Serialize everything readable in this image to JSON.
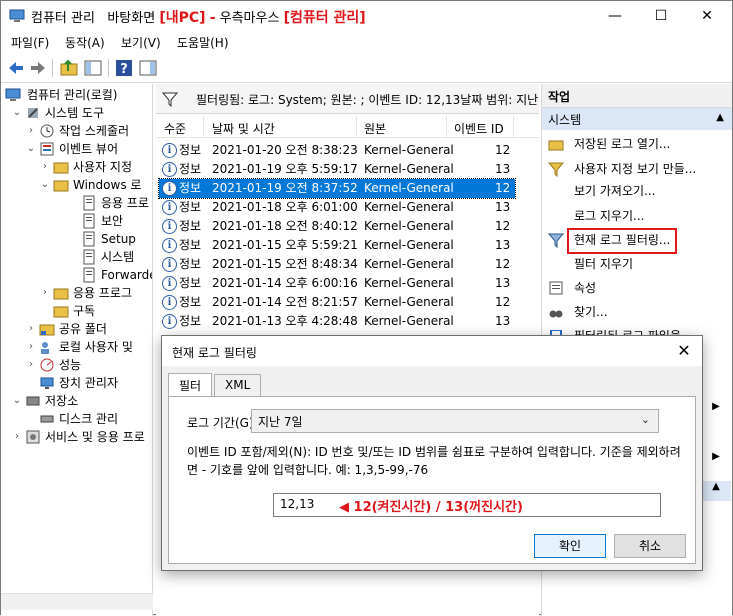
{
  "titlebar": {
    "app_title": "컴퓨터 관리",
    "desktop_label": "바탕화면",
    "tag_pc": "[내PC]",
    "dash": "-",
    "right_click": "우측마우스",
    "tag_cm": "[컴퓨터 관리]",
    "min_glyph": "—",
    "max_glyph": "☐",
    "close_glyph": "✕"
  },
  "menu": [
    "파일(F)",
    "동작(A)",
    "보기(V)",
    "도움말(H)"
  ],
  "tree": {
    "root": "컴퓨터 관리(로컬)",
    "items": [
      {
        "label": "시스템 도구",
        "level": 1
      },
      {
        "label": "작업 스케줄러",
        "level": 2
      },
      {
        "label": "이벤트 뷰어",
        "level": 2
      },
      {
        "label": "사용자 지정",
        "level": 3
      },
      {
        "label": "Windows 로",
        "level": 3
      },
      {
        "label": "응용 프로",
        "level": 4
      },
      {
        "label": "보안",
        "level": 4
      },
      {
        "label": "Setup",
        "level": 4
      },
      {
        "label": "시스템",
        "level": 4
      },
      {
        "label": "Forwarde",
        "level": 4
      },
      {
        "label": "응용 프로그",
        "level": 3
      },
      {
        "label": "구독",
        "level": 3
      },
      {
        "label": "공유 폴더",
        "level": 2
      },
      {
        "label": "로컬 사용자 및",
        "level": 2
      },
      {
        "label": "성능",
        "level": 2
      },
      {
        "label": "장치 관리자",
        "level": 2
      },
      {
        "label": "저장소",
        "level": 1
      },
      {
        "label": "디스크 관리",
        "level": 2
      },
      {
        "label": "서비스 및 응용 프로",
        "level": 1
      }
    ]
  },
  "filterbar": {
    "text": "필터링됨: 로그: System; 원본: ; 이벤트 ID: 12,13날짜 범위: 지난"
  },
  "grid": {
    "columns": [
      "수준",
      "날짜 및 시간",
      "원본",
      "이벤트 ID"
    ],
    "rows": [
      {
        "level": "정보",
        "datetime": "2021-01-20 오전 8:38:23",
        "source": "Kernel-General",
        "id": "12"
      },
      {
        "level": "정보",
        "datetime": "2021-01-19 오후 5:59:17",
        "source": "Kernel-General",
        "id": "13"
      },
      {
        "level": "정보",
        "datetime": "2021-01-19 오전 8:37:52",
        "source": "Kernel-General",
        "id": "12"
      },
      {
        "level": "정보",
        "datetime": "2021-01-18 오후 6:01:00",
        "source": "Kernel-General",
        "id": "13"
      },
      {
        "level": "정보",
        "datetime": "2021-01-18 오전 8:40:12",
        "source": "Kernel-General",
        "id": "12"
      },
      {
        "level": "정보",
        "datetime": "2021-01-15 오후 5:59:21",
        "source": "Kernel-General",
        "id": "13"
      },
      {
        "level": "정보",
        "datetime": "2021-01-15 오전 8:48:34",
        "source": "Kernel-General",
        "id": "12"
      },
      {
        "level": "정보",
        "datetime": "2021-01-14 오후 6:00:16",
        "source": "Kernel-General",
        "id": "13"
      },
      {
        "level": "정보",
        "datetime": "2021-01-14 오전 8:21:57",
        "source": "Kernel-General",
        "id": "12"
      },
      {
        "level": "정보",
        "datetime": "2021-01-13 오후 4:28:48",
        "source": "Kernel-General",
        "id": "13"
      }
    ],
    "selected_index": 2
  },
  "actions": {
    "header": "작업",
    "section": "시스템",
    "items": [
      "저장된 로그 열기...",
      "사용자 지정 보기 만들...",
      "보기 가져오기...",
      "로그 지우기...",
      "현재 로그 필터링...",
      "필터 지우기",
      "속성",
      "찾기...",
      "필터링된 로그 파일을..."
    ]
  },
  "dialog": {
    "title": "현재 로그 필터링",
    "close_glyph": "✕",
    "tabs": [
      "필터",
      "XML"
    ],
    "period_label": "로그 기간(G):",
    "period_value": "지난 7일",
    "desc": "이벤트 ID 포함/제외(N): ID 번호 및/또는 ID 범위를 쉼표로 구분하여 입력합니다. 기준을 제외하려면 - 기호를 앞에 입력합니다. 예: 1,3,5-99,-76",
    "id_value": "12,13",
    "annotation": "◀ 12(켜진시간) / 13(꺼진시간)",
    "ok": "확인",
    "cancel": "취소"
  },
  "colors": {
    "selection": "#0078d7",
    "annotation_red": "#e0161b",
    "section_blue": "#dbe7f6"
  }
}
